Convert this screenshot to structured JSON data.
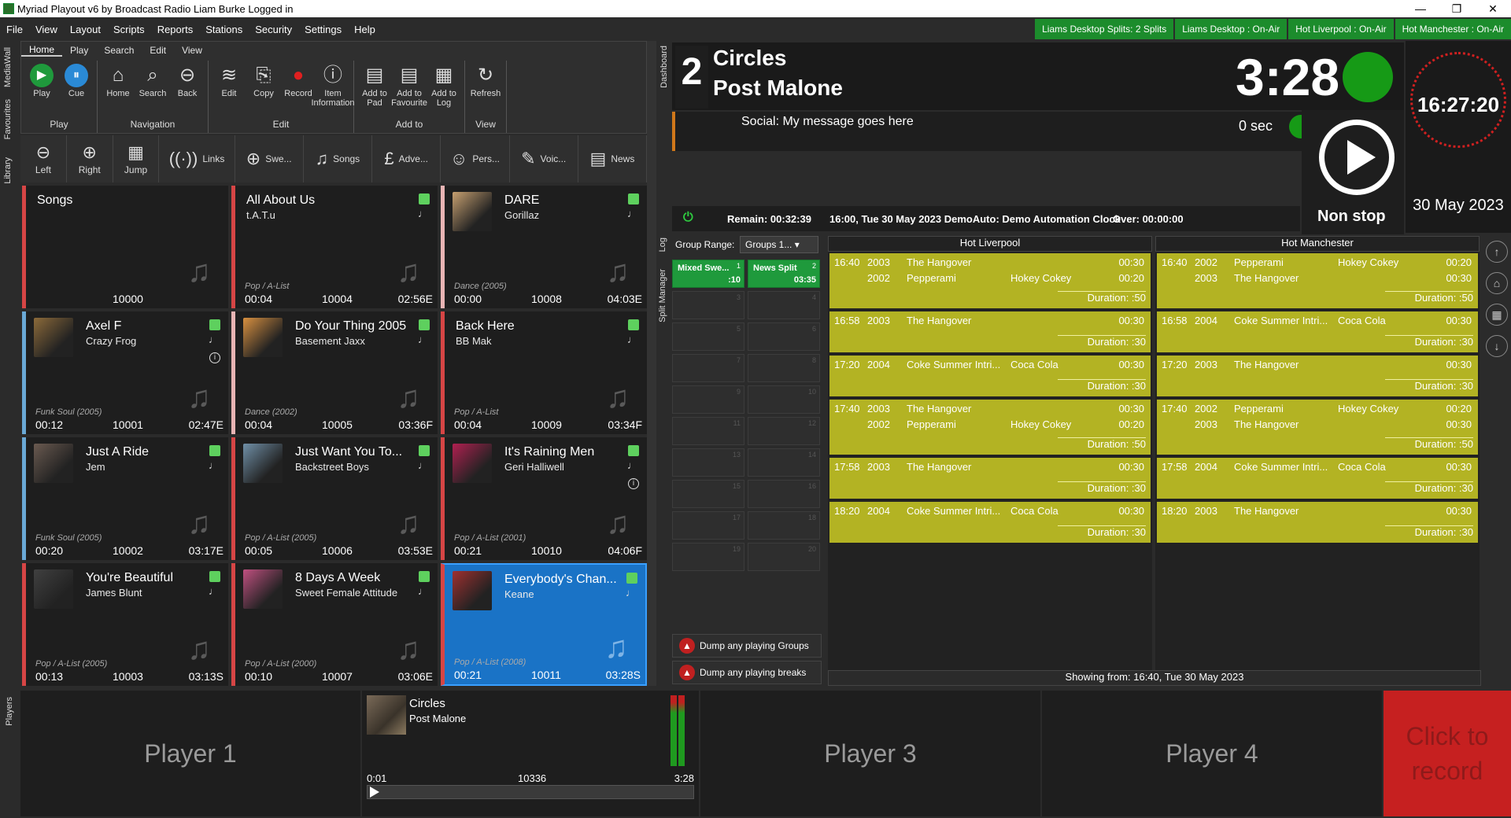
{
  "window": {
    "title": "Myriad Playout v6 by Broadcast Radio Liam Burke Logged in",
    "min": "—",
    "max": "❐",
    "close": "✕"
  },
  "menu": [
    "File",
    "View",
    "Layout",
    "Scripts",
    "Reports",
    "Stations",
    "Security",
    "Settings",
    "Help"
  ],
  "status": [
    "Liams Desktop Splits: 2 Splits",
    "Liams Desktop : On-Air",
    "Hot Liverpool : On-Air",
    "Hot Manchester : On-Air"
  ],
  "side_tabs": [
    "MediaWall",
    "Favourites",
    "Library"
  ],
  "ribbon": {
    "tabs": [
      "Home",
      "Play",
      "Search",
      "Edit",
      "View"
    ],
    "groups": [
      {
        "label": "Play",
        "buttons": [
          {
            "label": "Play",
            "icon": "play-icon"
          },
          {
            "label": "Cue",
            "icon": "pause-icon"
          }
        ]
      },
      {
        "label": "Navigation",
        "buttons": [
          {
            "label": "Home",
            "icon": "home-icon"
          },
          {
            "label": "Search",
            "icon": "search-icon"
          },
          {
            "label": "Back",
            "icon": "back-icon"
          }
        ]
      },
      {
        "label": "Edit",
        "buttons": [
          {
            "label": "Edit",
            "icon": "waveform-icon"
          },
          {
            "label": "Copy",
            "icon": "copy-icon"
          },
          {
            "label": "Record",
            "icon": "record-icon"
          },
          {
            "label": "Item Information",
            "icon": "info-icon"
          }
        ]
      },
      {
        "label": "Add to",
        "buttons": [
          {
            "label": "Add to Pad",
            "icon": "clipboard-add-icon"
          },
          {
            "label": "Add to Favourite",
            "icon": "clipboard-add-icon"
          },
          {
            "label": "Add to Log",
            "icon": "log-add-icon"
          }
        ]
      },
      {
        "label": "View",
        "buttons": [
          {
            "label": "Refresh",
            "icon": "refresh-icon"
          }
        ]
      }
    ]
  },
  "nav": [
    {
      "label": "Left",
      "icon": "left-arrow-icon"
    },
    {
      "label": "Right",
      "icon": "right-arrow-icon"
    },
    {
      "label": "Jump",
      "icon": "calculator-icon"
    },
    {
      "label": "Links",
      "icon": "antenna-icon"
    },
    {
      "label": "Swe...",
      "icon": "plus-circle-icon"
    },
    {
      "label": "Songs",
      "icon": "music-note-icon"
    },
    {
      "label": "Adve...",
      "icon": "pound-icon"
    },
    {
      "label": "Pers...",
      "icon": "person-icon"
    },
    {
      "label": "Voic...",
      "icon": "pen-icon"
    },
    {
      "label": "News",
      "icon": "newspaper-icon"
    }
  ],
  "carts": [
    {
      "title": "Songs",
      "artist": "",
      "cat": "",
      "intro": "",
      "num": "10000",
      "dur": "",
      "art": "",
      "flag": false,
      "info": false,
      "border": "red",
      "sel": false
    },
    {
      "title": "All About Us",
      "artist": "t.A.T.u",
      "cat": "Pop / A-List",
      "intro": "00:04",
      "num": "10004",
      "dur": "02:56E",
      "art": "",
      "flag": true,
      "info": false,
      "border": "red",
      "sel": false
    },
    {
      "title": "DARE",
      "artist": "Gorillaz",
      "cat": "Dance (2005)",
      "intro": "00:00",
      "num": "10008",
      "dur": "04:03E",
      "art": "#c7a070",
      "flag": true,
      "info": false,
      "border": "pink",
      "sel": false
    },
    {
      "title": "Axel F",
      "artist": "Crazy Frog",
      "cat": "Funk Soul (2005)",
      "intro": "00:12",
      "num": "10001",
      "dur": "02:47E",
      "art": "#8c6a3a",
      "flag": true,
      "info": true,
      "border": "blue",
      "sel": false
    },
    {
      "title": "Do Your Thing 2005",
      "artist": "Basement Jaxx",
      "cat": "Dance (2002)",
      "intro": "00:04",
      "num": "10005",
      "dur": "03:36F",
      "art": "#d89040",
      "flag": true,
      "info": false,
      "border": "pink",
      "sel": false
    },
    {
      "title": "Back Here",
      "artist": "BB Mak",
      "cat": "Pop / A-List",
      "intro": "00:04",
      "num": "10009",
      "dur": "03:34F",
      "art": "",
      "flag": true,
      "info": false,
      "border": "red",
      "sel": false
    },
    {
      "title": "Just A Ride",
      "artist": "Jem",
      "cat": "Funk Soul (2005)",
      "intro": "00:20",
      "num": "10002",
      "dur": "03:17E",
      "art": "#6a5a50",
      "flag": true,
      "info": false,
      "border": "blue",
      "sel": false
    },
    {
      "title": "Just Want You To...",
      "artist": "Backstreet Boys",
      "cat": "Pop / A-List (2005)",
      "intro": "00:05",
      "num": "10006",
      "dur": "03:53E",
      "art": "#7090a8",
      "flag": true,
      "info": false,
      "border": "red",
      "sel": false
    },
    {
      "title": "It's Raining Men",
      "artist": "Geri Halliwell",
      "cat": "Pop / A-List (2001)",
      "intro": "00:21",
      "num": "10010",
      "dur": "04:06F",
      "art": "#b02050",
      "flag": true,
      "info": true,
      "border": "red",
      "sel": false
    },
    {
      "title": "You're Beautiful",
      "artist": "James Blunt",
      "cat": "Pop / A-List (2005)",
      "intro": "00:13",
      "num": "10003",
      "dur": "03:13S",
      "art": "#404040",
      "flag": true,
      "info": false,
      "border": "red",
      "sel": false
    },
    {
      "title": "8 Days A Week",
      "artist": "Sweet Female Attitude",
      "cat": "Pop / A-List (2000)",
      "intro": "00:10",
      "num": "10007",
      "dur": "03:06E",
      "art": "#c05080",
      "flag": true,
      "info": false,
      "border": "red",
      "sel": false
    },
    {
      "title": "Everybody's Chan...",
      "artist": "Keane",
      "cat": "Pop / A-List (2008)",
      "intro": "00:21",
      "num": "10011",
      "dur": "03:28S",
      "art": "#a03030",
      "flag": true,
      "info": false,
      "border": "red",
      "sel": true
    }
  ],
  "dashboard": {
    "tab": "Dashboard",
    "player_num": "2",
    "title": "Circles",
    "artist": "Post Malone",
    "time": "3:28",
    "social": "Social: My message goes here",
    "sec": "0 sec",
    "mode": "Non stop",
    "remain": "Remain:  00:32:39",
    "clock_info": "16:00, Tue 30 May 2023  DemoAuto: Demo Automation Clock",
    "over": "Over:  00:00:00"
  },
  "clock": {
    "time": "16:27:20",
    "date": "30 May 2023"
  },
  "split": {
    "tabs": [
      "Log",
      "Split Manager"
    ],
    "range_label": "Group Range:",
    "range_value": "Groups 1...",
    "cells": [
      {
        "label": "Mixed Swe...",
        "n": "1",
        "d": ":10",
        "g": true
      },
      {
        "label": "News Split",
        "n": "2",
        "d": "03:35",
        "g": true
      },
      {
        "n": "3"
      },
      {
        "n": "4"
      },
      {
        "n": "5"
      },
      {
        "n": "6"
      },
      {
        "n": "7"
      },
      {
        "n": "8"
      },
      {
        "n": "9"
      },
      {
        "n": "10"
      },
      {
        "n": "11"
      },
      {
        "n": "12"
      },
      {
        "n": "13"
      },
      {
        "n": "14"
      },
      {
        "n": "15"
      },
      {
        "n": "16"
      },
      {
        "n": "17"
      },
      {
        "n": "18"
      },
      {
        "n": "19"
      },
      {
        "n": "20"
      }
    ],
    "dump1": "Dump any playing Groups",
    "dump2": "Dump any playing breaks"
  },
  "stations": [
    {
      "name": "Hot Liverpool",
      "breaks": [
        {
          "time": "16:40",
          "rows": [
            [
              "2003",
              "The Hangover",
              "",
              "00:30"
            ],
            [
              "2002",
              "Pepperami",
              "Hokey Cokey",
              "00:20"
            ]
          ],
          "dur": "Duration:  :50"
        },
        {
          "time": "16:58",
          "rows": [
            [
              "2003",
              "The Hangover",
              "",
              "00:30"
            ]
          ],
          "dur": "Duration:  :30"
        },
        {
          "time": "17:20",
          "rows": [
            [
              "2004",
              "Coke Summer Intri...",
              "Coca Cola",
              "00:30"
            ]
          ],
          "dur": "Duration:  :30"
        },
        {
          "time": "17:40",
          "rows": [
            [
              "2003",
              "The Hangover",
              "",
              "00:30"
            ],
            [
              "2002",
              "Pepperami",
              "Hokey Cokey",
              "00:20"
            ]
          ],
          "dur": "Duration:  :50"
        },
        {
          "time": "17:58",
          "rows": [
            [
              "2003",
              "The Hangover",
              "",
              "00:30"
            ]
          ],
          "dur": "Duration:  :30"
        },
        {
          "time": "18:20",
          "rows": [
            [
              "2004",
              "Coke Summer Intri...",
              "Coca Cola",
              "00:30"
            ]
          ],
          "dur": "Duration:  :30"
        }
      ]
    },
    {
      "name": "Hot Manchester",
      "breaks": [
        {
          "time": "16:40",
          "rows": [
            [
              "2002",
              "Pepperami",
              "Hokey Cokey",
              "00:20"
            ],
            [
              "2003",
              "The Hangover",
              "",
              "00:30"
            ]
          ],
          "dur": "Duration:  :50"
        },
        {
          "time": "16:58",
          "rows": [
            [
              "2004",
              "Coke Summer Intri...",
              "Coca Cola",
              "00:30"
            ]
          ],
          "dur": "Duration:  :30"
        },
        {
          "time": "17:20",
          "rows": [
            [
              "2003",
              "The Hangover",
              "",
              "00:30"
            ]
          ],
          "dur": "Duration:  :30"
        },
        {
          "time": "17:40",
          "rows": [
            [
              "2002",
              "Pepperami",
              "Hokey Cokey",
              "00:20"
            ],
            [
              "2003",
              "The Hangover",
              "",
              "00:30"
            ]
          ],
          "dur": "Duration:  :50"
        },
        {
          "time": "17:58",
          "rows": [
            [
              "2004",
              "Coke Summer Intri...",
              "Coca Cola",
              "00:30"
            ]
          ],
          "dur": "Duration:  :30"
        },
        {
          "time": "18:20",
          "rows": [
            [
              "2003",
              "The Hangover",
              "",
              "00:30"
            ]
          ],
          "dur": "Duration:  :30"
        }
      ]
    }
  ],
  "showing": "Showing from: 16:40, Tue 30 May 2023",
  "players": {
    "tab": "Players",
    "p1": "Player 1",
    "p3": "Player 3",
    "p4": "Player 4",
    "record": "Click to record",
    "p2": {
      "title": "Circles",
      "artist": "Post Malone",
      "pos": "0:01",
      "num": "10336",
      "len": "3:28"
    }
  }
}
